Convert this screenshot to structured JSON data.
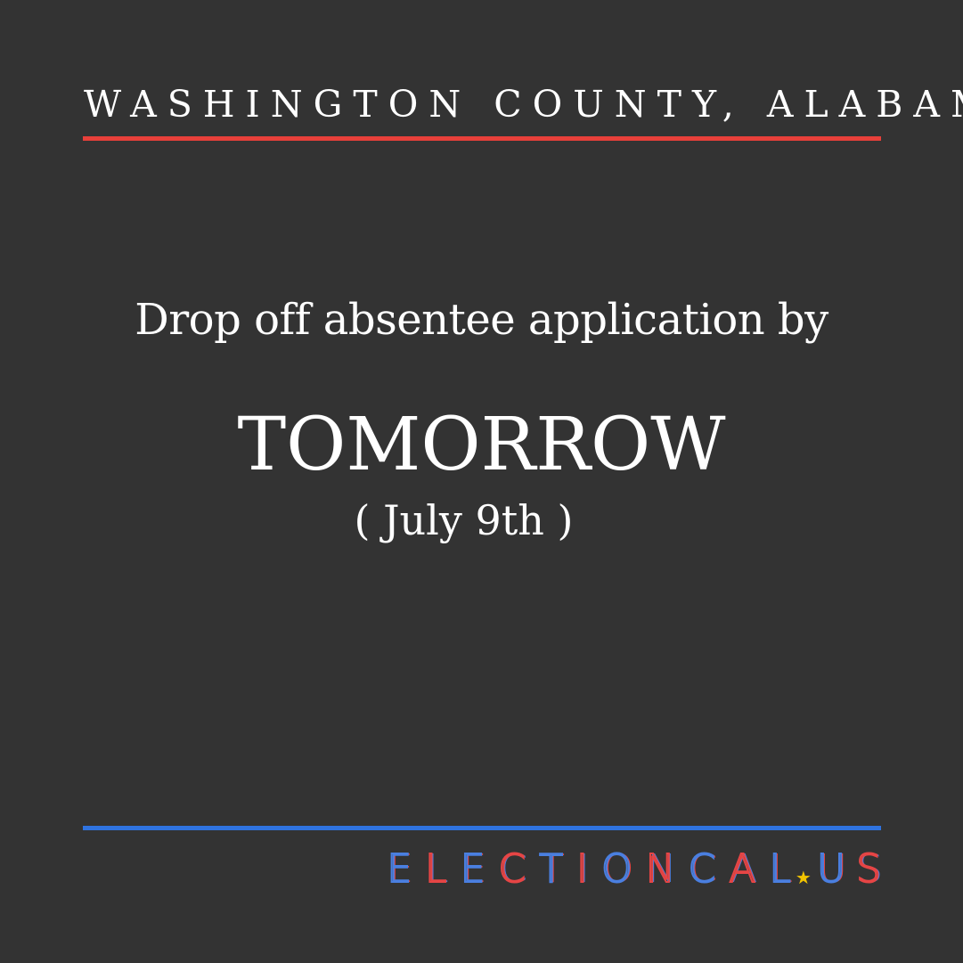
{
  "header": {
    "title": "WASHINGTON COUNTY, ALABAMA"
  },
  "message": {
    "line1": "Drop off absentee application by",
    "deadline": "TOMORROW",
    "date": "( July 9th )"
  },
  "brand": {
    "name": "ELECTIONCAL",
    "star": "★",
    "tld": "US"
  },
  "colors": {
    "background": "#333333",
    "accent_red": "#e8403a",
    "accent_blue": "#2f73e0",
    "brand_red": "#e64545",
    "brand_blue": "#4a7fe0",
    "star_yellow": "#f2c400"
  }
}
